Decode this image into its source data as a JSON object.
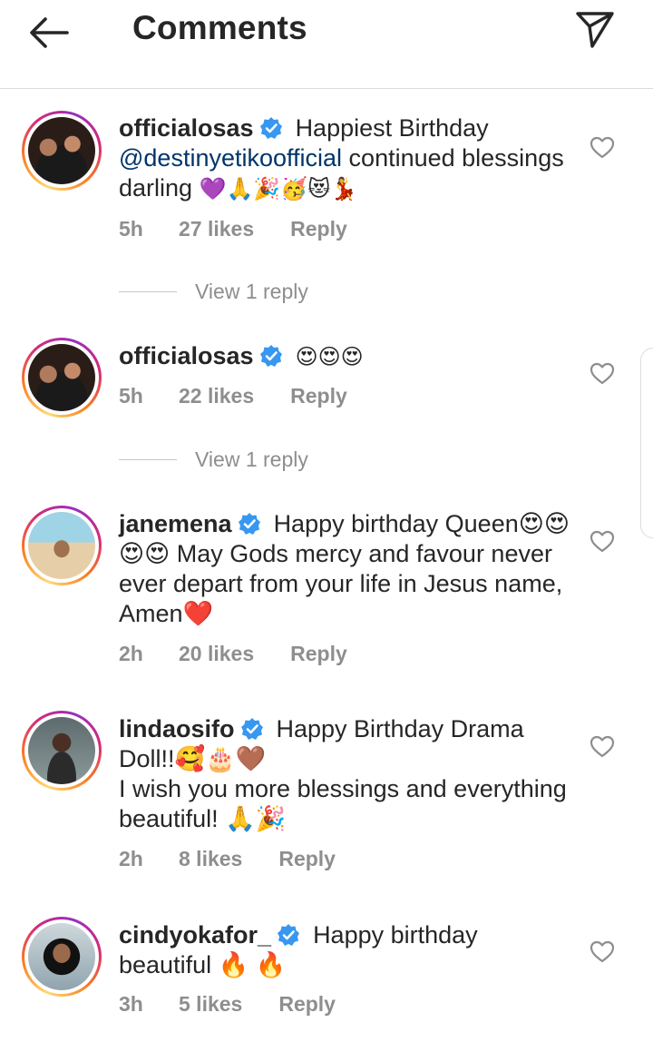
{
  "header": {
    "title": "Comments"
  },
  "comments": [
    {
      "username": "officialosas",
      "pre_text": "Happiest Birthday ",
      "mention": "@destinyetikoofficial",
      "post_text": " continued blessings darling ",
      "emojis": "💜🙏🎉🥳😻💃",
      "time": "5h",
      "likes": "27 likes",
      "reply": "Reply"
    },
    {
      "username": "officialosas",
      "text": "",
      "emojis": "😍😍😍",
      "time": "5h",
      "likes": "22 likes",
      "reply": "Reply"
    },
    {
      "username": "janemena",
      "text": "Happy birthday Queen😍😍😍😍 May Gods mercy and favour never ever depart from your life in Jesus name, Amen❤️",
      "time": "2h",
      "likes": "20 likes",
      "reply": "Reply"
    },
    {
      "username": "lindaosifo",
      "line1": "Happy Birthday Drama Doll!!🥰🎂🤎",
      "line2": "I wish you more blessings and everything beautiful! 🙏🎉",
      "time": "2h",
      "likes": "8 likes",
      "reply": "Reply"
    },
    {
      "username": "cindyokafor_",
      "text": "Happy birthday beautiful 🔥 🔥",
      "time": "3h",
      "likes": "5 likes",
      "reply": "Reply"
    }
  ],
  "view_replies": [
    "View 1 reply",
    "View 1 reply"
  ],
  "colors": {
    "text": "#262626",
    "meta": "#8e8e8e",
    "mention": "#003569",
    "verified": "#3897f0"
  }
}
